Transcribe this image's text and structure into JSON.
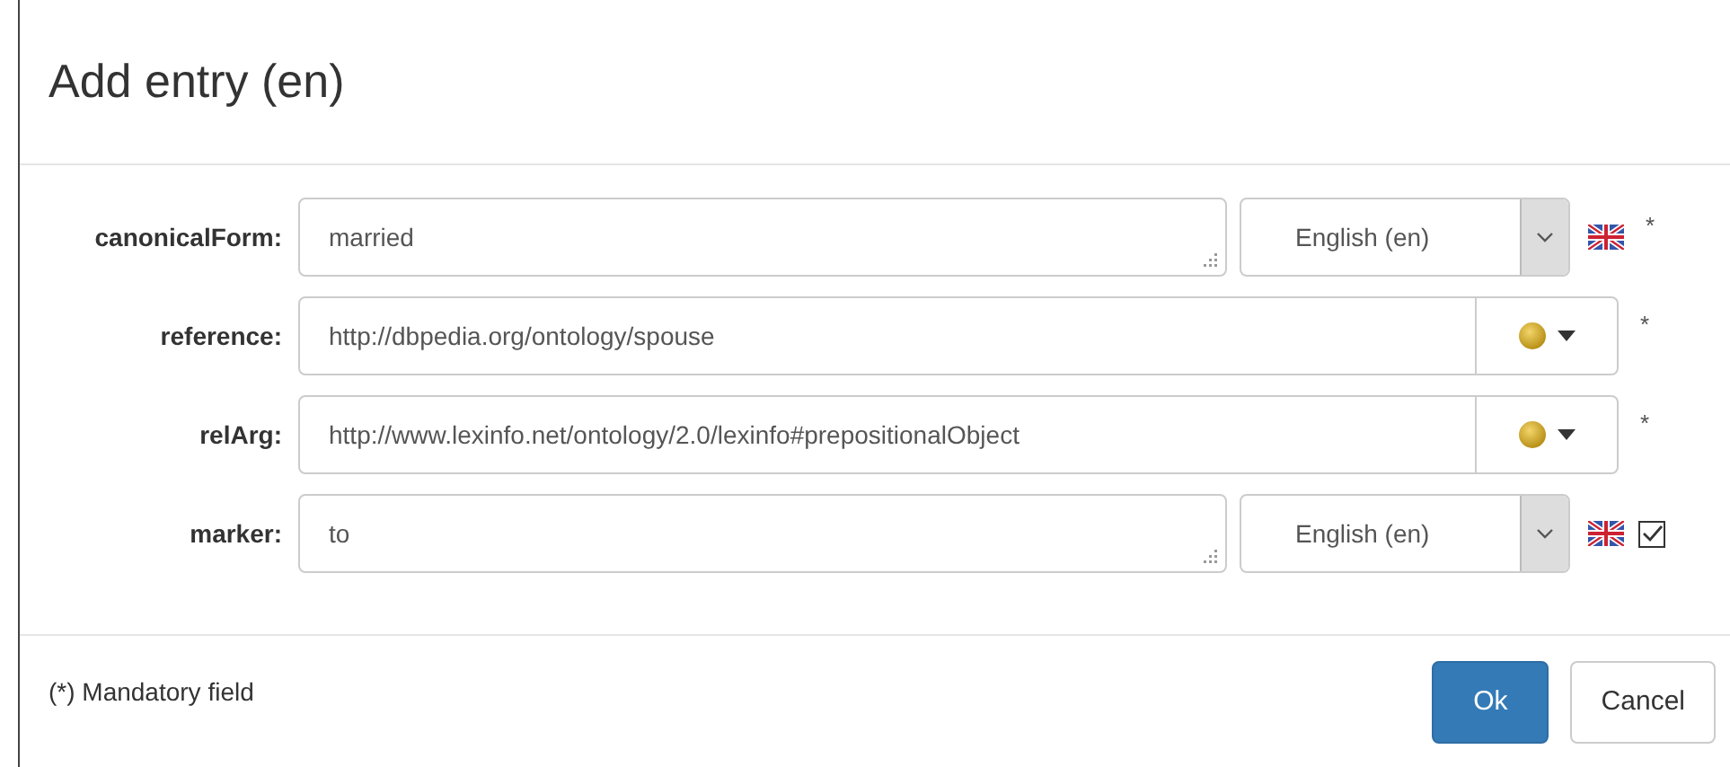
{
  "dialog": {
    "title": "Add entry (en)"
  },
  "fields": [
    {
      "kind": "text_lang",
      "label": "canonicalForm:",
      "value": "married",
      "language": "English (en)",
      "mandatory": "*"
    },
    {
      "kind": "uri",
      "label": "reference:",
      "value": "http://dbpedia.org/ontology/spouse",
      "mandatory": "*"
    },
    {
      "kind": "uri",
      "label": "relArg:",
      "value": "http://www.lexinfo.net/ontology/2.0/lexinfo#prepositionalObject",
      "mandatory": "*"
    },
    {
      "kind": "text_lang",
      "label": "marker:",
      "value": "to",
      "language": "English (en)",
      "checked": true
    }
  ],
  "footer": {
    "note": "(*) Mandatory field",
    "buttons": [
      {
        "label": "Ok",
        "kind": "primary"
      },
      {
        "label": "Cancel",
        "kind": "default"
      }
    ]
  }
}
